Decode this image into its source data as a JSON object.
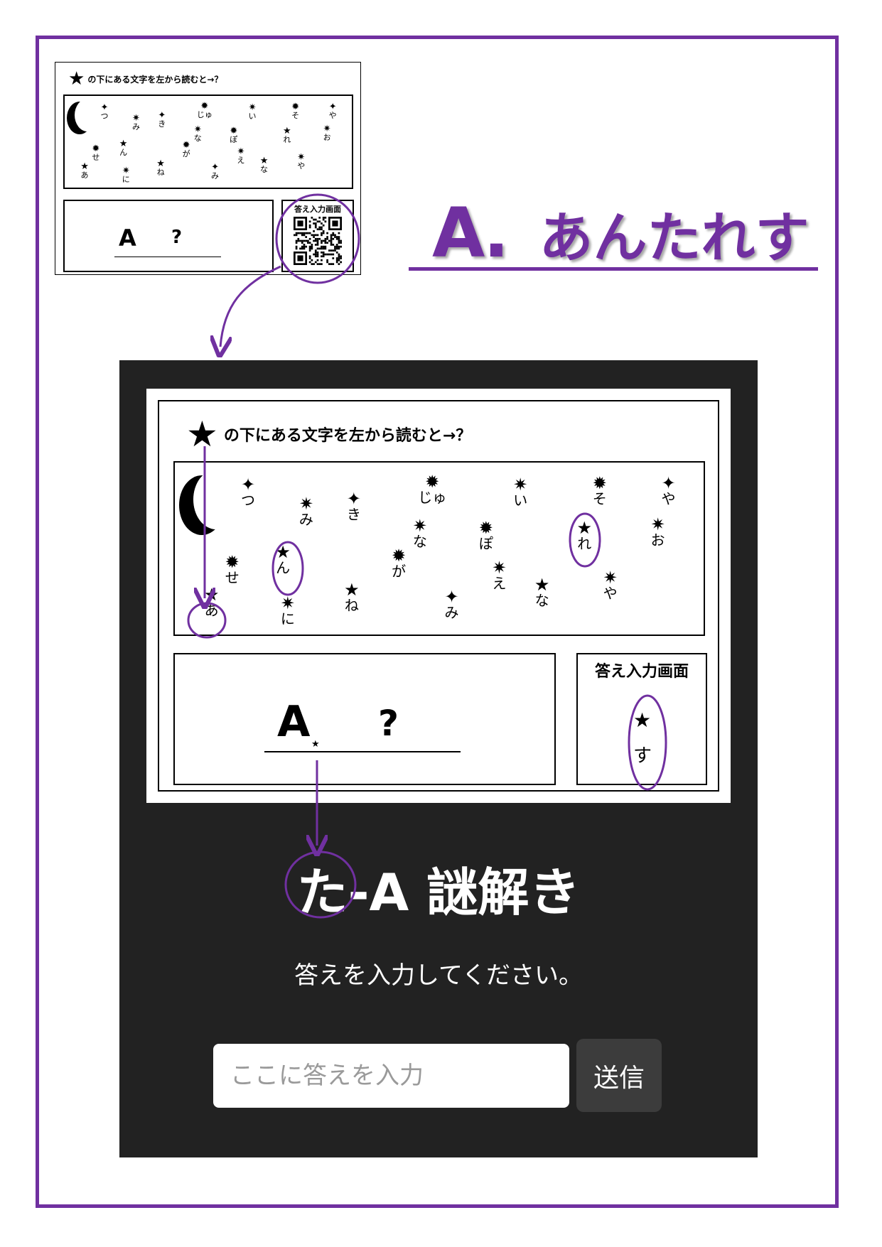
{
  "puzzle": {
    "star_symbol": "★",
    "instruction": "の下にある文字を左から読むと→？",
    "answer_prefix": "A",
    "answer_small_star": "★",
    "answer_unknown": "?",
    "qr_label": "答え入力画面",
    "qr_star_char": "す",
    "marks": [
      {
        "sym": "✦",
        "ch": "つ"
      },
      {
        "sym": "✷",
        "ch": "み"
      },
      {
        "sym": "✦",
        "ch": "き"
      },
      {
        "sym": "✹",
        "ch": "じゅ"
      },
      {
        "sym": "✷",
        "ch": "い"
      },
      {
        "sym": "✹",
        "ch": "そ"
      },
      {
        "sym": "✦",
        "ch": "や"
      },
      {
        "sym": "✷",
        "ch": "な"
      },
      {
        "sym": "✹",
        "ch": "ぽ"
      },
      {
        "sym": "★",
        "ch": "れ"
      },
      {
        "sym": "✷",
        "ch": "お"
      },
      {
        "sym": "★",
        "ch": "ん"
      },
      {
        "sym": "✹",
        "ch": "せ"
      },
      {
        "sym": "✹",
        "ch": "が"
      },
      {
        "sym": "✷",
        "ch": "え"
      },
      {
        "sym": "★",
        "ch": "な"
      },
      {
        "sym": "✷",
        "ch": "や"
      },
      {
        "sym": "★",
        "ch": "あ"
      },
      {
        "sym": "✷",
        "ch": "に"
      },
      {
        "sym": "★",
        "ch": "ね"
      },
      {
        "sym": "✦",
        "ch": "み"
      }
    ]
  },
  "answer_display": {
    "prefix": "A.",
    "text": "あんたれす"
  },
  "web": {
    "title": "た-A 謎解き",
    "instruction": "答えを入力してください。",
    "input_placeholder": "ここに答えを入力",
    "submit_label": "送信"
  },
  "colors": {
    "accent": "#7030a0",
    "dark_bg": "#222222",
    "button_bg": "#3c3c3c"
  }
}
